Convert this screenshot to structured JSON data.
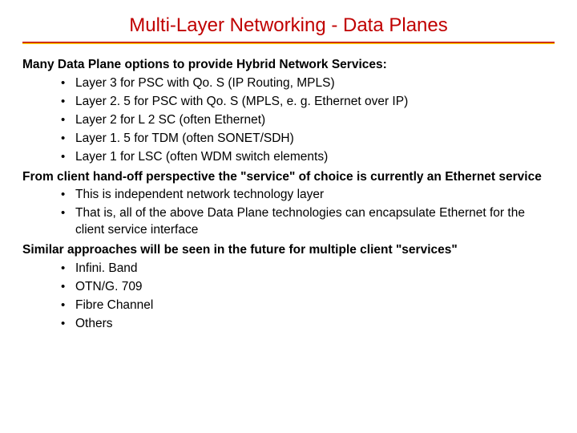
{
  "title": "Multi-Layer Networking - Data Planes",
  "sections": [
    {
      "heading": "Many Data Plane options to provide Hybrid Network Services:",
      "items": [
        "Layer 3 for PSC with Qo. S (IP Routing, MPLS)",
        "Layer 2. 5 for PSC with Qo. S (MPLS, e. g. Ethernet over IP)",
        "Layer 2 for L 2 SC (often Ethernet)",
        "Layer 1. 5 for TDM (often SONET/SDH)",
        "Layer 1 for LSC (often WDM switch elements)"
      ]
    },
    {
      "heading": "From client hand-off perspective the \"service\" of choice is currently an Ethernet service",
      "items": [
        "This is independent network technology layer",
        "That is, all of the above Data Plane technologies can encapsulate Ethernet for the client service interface"
      ]
    },
    {
      "heading": "Similar approaches will be seen in the future for multiple client \"services\"",
      "items": [
        "Infini. Band",
        "OTN/G. 709",
        "Fibre Channel",
        "Others"
      ]
    }
  ]
}
